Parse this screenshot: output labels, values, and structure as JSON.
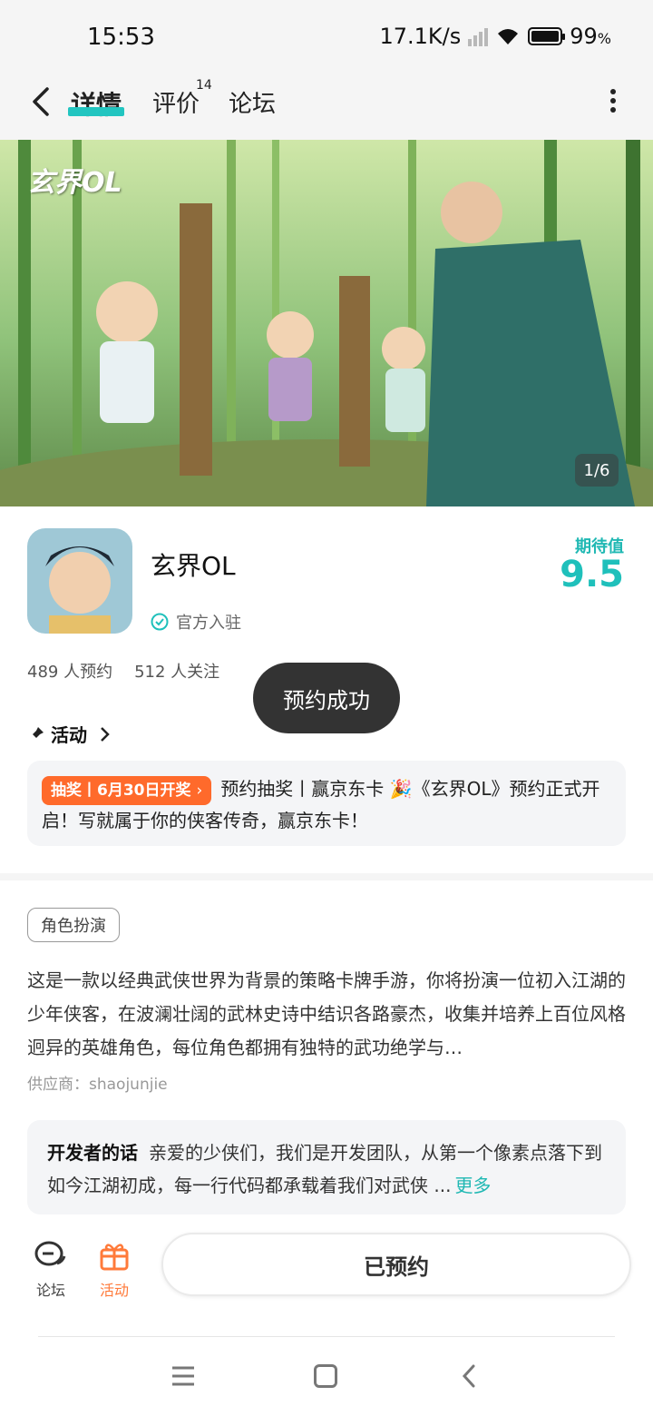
{
  "status": {
    "time": "15:53",
    "speed": "17.1K/s",
    "battery": "99",
    "battery_unit": "%"
  },
  "nav": {
    "tabs": [
      {
        "label": "详情"
      },
      {
        "label": "评价",
        "count": "14"
      },
      {
        "label": "论坛"
      }
    ]
  },
  "banner": {
    "logo_text": "玄界OL",
    "counter": "1/6"
  },
  "app": {
    "name": "玄界OL",
    "official_label": "官方入驻",
    "expectation_label": "期待值",
    "expectation_value": "9.5",
    "reservations": "489 人预约",
    "followers": "512 人关注"
  },
  "toast": {
    "text": "预约成功"
  },
  "activity": {
    "heading": "活动",
    "badge": "抽奖丨6月30日开奖",
    "text": "预约抽奖丨赢京东卡 🎉《玄界OL》预约正式开启！写就属于你的侠客传奇，赢京东卡！"
  },
  "genre_tag": "角色扮演",
  "description": "这是一款以经典武侠世界为背景的策略卡牌手游，你将扮演一位初入江湖的少年侠客，在波澜壮阔的武林史诗中结识各路豪杰，收集并培养上百位风格迥异的英雄角色，每位角色都拥有独特的武功绝学与…",
  "supplier": "供应商：shaojunjie",
  "developer": {
    "title": "开发者的话",
    "text": "亲爱的少侠们，我们是开发团队，从第一个像素点落下到如今江湖初成，每一行代码都承载着我们对武侠 ...",
    "more": "更多"
  },
  "bottom_bar": {
    "forum_label": "论坛",
    "activity_label": "活动",
    "reserve_button": "已预约"
  },
  "colors": {
    "accent": "#1fc0bb",
    "orange": "#ff6a2b",
    "toast": "#333333"
  }
}
